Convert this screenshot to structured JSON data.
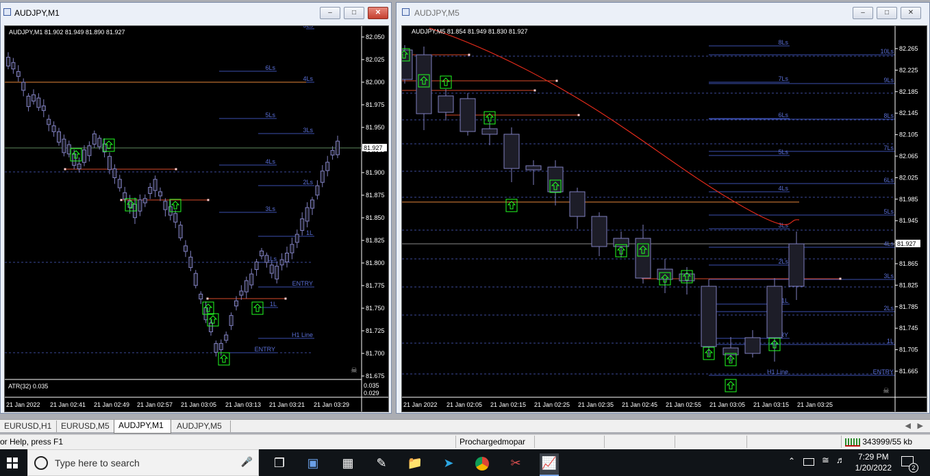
{
  "windows": {
    "m1": {
      "title": "AUDJPY,M1",
      "info": "AUDJPY,M1  81.902 81.949 81.890 81.927",
      "indicator": "ATR(32) 0.035",
      "indicator_scale": [
        "0.035",
        "0.029"
      ],
      "price_labels": [
        "82.050",
        "82.025",
        "82.000",
        "81.975",
        "81.950",
        "81.925",
        "81.900",
        "81.875",
        "81.850",
        "81.825",
        "81.800",
        "81.775",
        "81.750",
        "81.725",
        "81.700",
        "81.675"
      ],
      "current_price": "81.927",
      "time_labels": [
        "21 Jan 2022",
        "21 Jan 02:41",
        "21 Jan 02:49",
        "21 Jan 02:57",
        "21 Jan 03:05",
        "21 Jan 03:13",
        "21 Jan 03:21",
        "21 Jan 03:29"
      ],
      "level_labels": [
        "5Ls",
        "6Ls",
        "4Ls",
        "5Ls",
        "3Ls",
        "4Ls",
        "2Ls",
        "3Ls",
        "1L",
        "1Ls",
        "ENTRY",
        "1L",
        "H1 Line",
        "ENTRY"
      ]
    },
    "m5": {
      "title": "AUDJPY,M5",
      "info": "AUDJPY,M5  81.854 81.949 81.830 81.927",
      "price_labels": [
        "82.265",
        "82.225",
        "82.185",
        "82.145",
        "82.105",
        "82.065",
        "82.025",
        "81.985",
        "81.945",
        "81.905",
        "81.865",
        "81.825",
        "81.785",
        "81.745",
        "81.705",
        "81.665"
      ],
      "current_price": "81.927",
      "time_labels": [
        "21 Jan 2022",
        "21 Jan 02:05",
        "21 Jan 02:15",
        "21 Jan 02:25",
        "21 Jan 02:35",
        "21 Jan 02:45",
        "21 Jan 02:55",
        "21 Jan 03:05",
        "21 Jan 03:15",
        "21 Jan 03:25"
      ],
      "level_labels": [
        "8Ls",
        "10Ls",
        "7Ls",
        "9Ls",
        "6Ls",
        "8Ls",
        "7Ls",
        "5Ls",
        "6Ls",
        "4Ls",
        "5Ls",
        "3Ls",
        "4Ls",
        "2Ls",
        "3Ls",
        "1L",
        "2Ls",
        "ENTRY",
        "1L",
        "H1 Line",
        "ENTRY"
      ]
    }
  },
  "tabs": [
    {
      "label": "EURUSD,H1"
    },
    {
      "label": "EURUSD,M5"
    },
    {
      "label": "AUDJPY,M1"
    },
    {
      "label": "AUDJPY,M5"
    }
  ],
  "status": {
    "help": "or Help, press F1",
    "profile": "Prochargedmopar",
    "traffic": "343999/55 kb"
  },
  "taskbar": {
    "search_placeholder": "Type here to search",
    "time": "7:29 PM",
    "date": "1/20/2022",
    "notifications": "2"
  },
  "colors": {
    "chart_bg": "#000000",
    "level_line": "#3b4fb0",
    "level_text": "#5a6fd6",
    "red_line": "#d84a2a",
    "arrow": "#22ff22",
    "candle_body": "#1d1d28"
  }
}
